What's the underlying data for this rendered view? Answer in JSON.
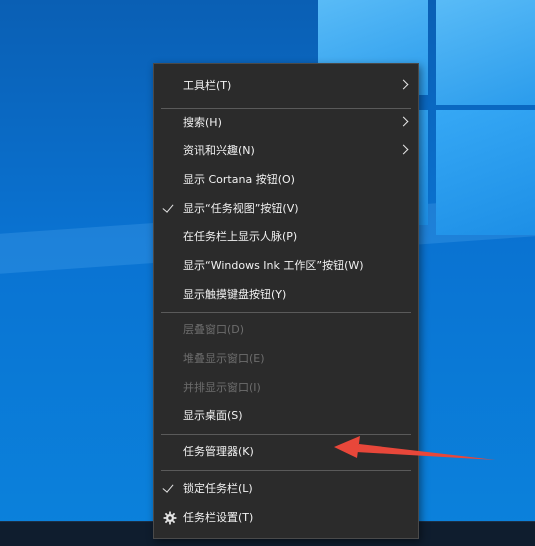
{
  "theme": {
    "accent_arrow": "#e8473a",
    "menu_bg": "#2b2b2b"
  },
  "menu": {
    "items": [
      {
        "label": "工具栏(T)",
        "submenu": true
      },
      {
        "label": "搜索(H)",
        "submenu": true
      },
      {
        "label": "资讯和兴趣(N)",
        "submenu": true
      },
      {
        "label": "显示 Cortana 按钮(O)"
      },
      {
        "label": "显示“任务视图”按钮(V)",
        "checked": true
      },
      {
        "label": "在任务栏上显示人脉(P)"
      },
      {
        "label": "显示“Windows Ink 工作区”按钮(W)"
      },
      {
        "label": "显示触摸键盘按钮(Y)"
      },
      {
        "label": "层叠窗口(D)",
        "disabled": true
      },
      {
        "label": "堆叠显示窗口(E)",
        "disabled": true
      },
      {
        "label": "并排显示窗口(I)",
        "disabled": true
      },
      {
        "label": "显示桌面(S)"
      },
      {
        "label": "任务管理器(K)"
      },
      {
        "label": "锁定任务栏(L)",
        "checked": true
      },
      {
        "label": "任务栏设置(T)",
        "icon": "gear-icon"
      }
    ]
  }
}
